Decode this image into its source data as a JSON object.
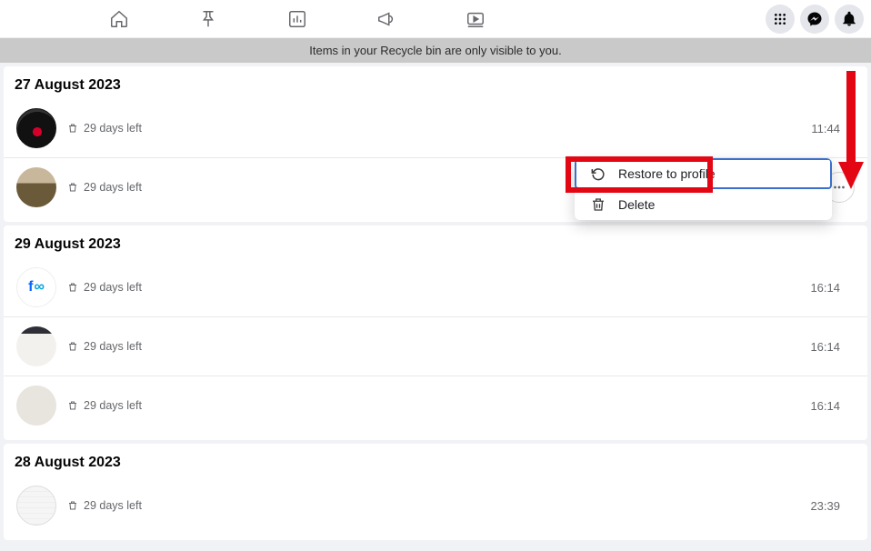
{
  "banner": {
    "text": "Items in your Recycle bin are only visible to you."
  },
  "menu": {
    "restore_label": "Restore to profile",
    "delete_label": "Delete"
  },
  "sections": [
    {
      "date": "27 August 2023",
      "items": [
        {
          "days_left": "29 days left",
          "time": "11:44"
        },
        {
          "days_left": "29 days left",
          "time": ""
        }
      ]
    },
    {
      "date": "29 August 2023",
      "items": [
        {
          "days_left": "29 days left",
          "time": "16:14"
        },
        {
          "days_left": "29 days left",
          "time": "16:14"
        },
        {
          "days_left": "29 days left",
          "time": "16:14"
        }
      ]
    },
    {
      "date": "28 August 2023",
      "items": [
        {
          "days_left": "29 days left",
          "time": "23:39"
        }
      ]
    }
  ]
}
